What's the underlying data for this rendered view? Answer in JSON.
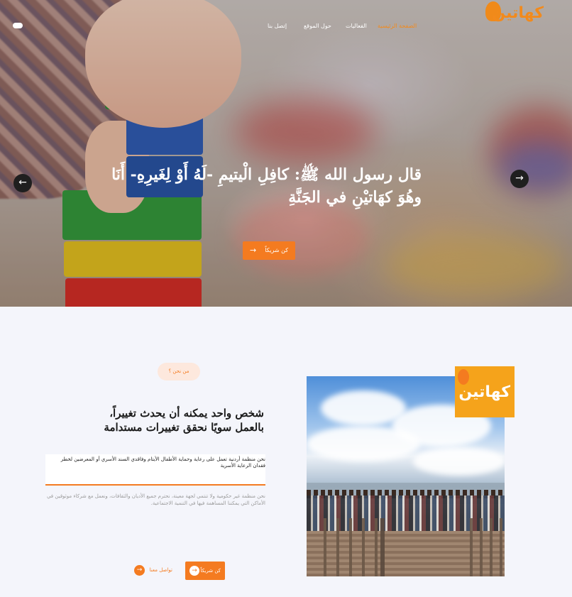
{
  "logo": {
    "text": "كهاتين"
  },
  "nav": {
    "items": [
      {
        "label": "الصفحة الرئيسية",
        "active": true
      },
      {
        "label": "الفعاليات",
        "active": false
      },
      {
        "label": "حول الموقع",
        "active": false
      },
      {
        "label": "إتصل بنا",
        "active": false
      }
    ]
  },
  "hero": {
    "title": "قال رسول الله ﷺ: كافِلِ الْيتيمِ -لَهُ أَوْ لِغَيرِهِ- أَنَا وهُوَ كهَاتيْنِ في الجَنَّةِ",
    "cta_label": "كن شريكاً",
    "prev_icon": "←",
    "next_icon": "→"
  },
  "about": {
    "pill": "من نحن ؟",
    "heading_line1": "شخص واحد يمكنه أن يحدث تغييراً،",
    "heading_line2": "بالعمل سويًا نحقق تغييرات مستدامة",
    "box_text": "نحن منظمة أردنية تعمل على رعاية وحماية الأطفال الأيتام وفاقدي السند الأسري أو المعرضين لخطر فقدان الرعاية الأسرية",
    "description": "نحن منظمة غير حكومية ولا تنتمي لجهة معينة، نحترم جميع الأديان والثقافات، ونعمل مع شركاء موثوقين في الأماكن التي يمكننا المساهمة فيها في التنمية الاجتماعية.",
    "partner_button": "كن شريكاً",
    "contact_button": "تواصل معنا"
  },
  "badge": {
    "text": "كهاتين"
  },
  "colors": {
    "accent": "#f47b20",
    "pill_bg": "#fde8dd",
    "page_bg": "#f4f5fb"
  }
}
